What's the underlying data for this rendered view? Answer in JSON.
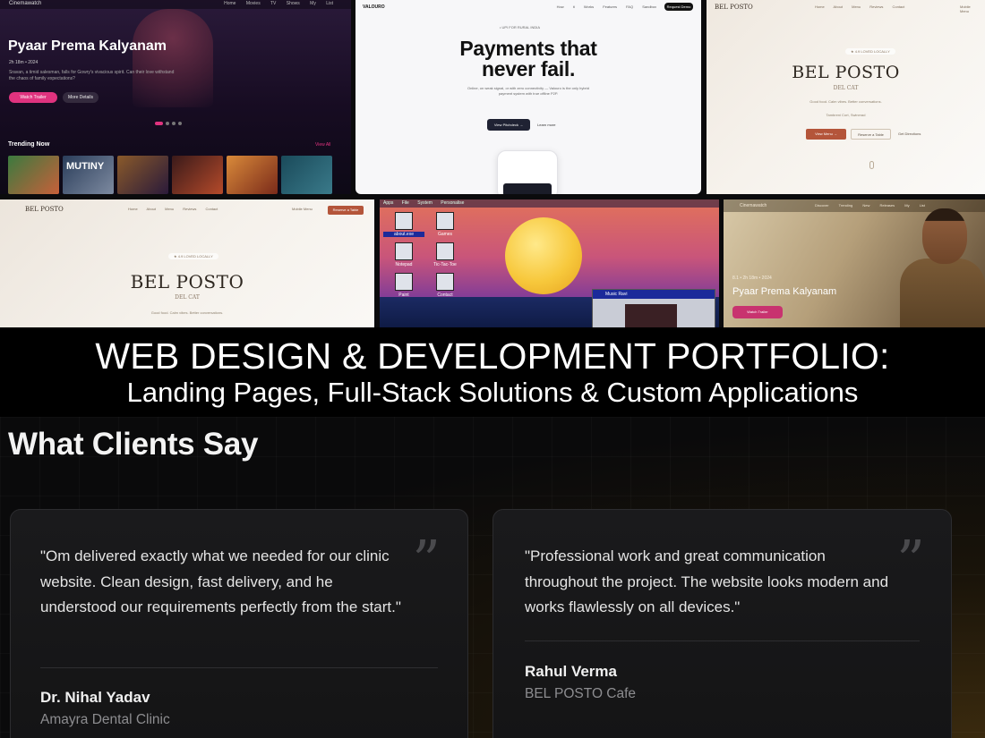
{
  "collage": {
    "streaming": {
      "brand": "Cinemawatch",
      "nav_links": "Home  Movies  TV Shows  My List",
      "hero_title": "Pyaar Prema Kalyanam",
      "meta": "2h 18m  •  2024",
      "description": "Sravan, a timid salesman, falls for Gowry's vivacious spirit. Can their love withstand the chaos of family expectations?",
      "watch_button": "Watch Trailer",
      "more_button": "More Details",
      "trending_label": "Trending Now",
      "view_all": "View All",
      "thumbnails": [
        {
          "label": "",
          "colors": [
            "#3b7a3f",
            "#c7603a"
          ]
        },
        {
          "label": "MUTINY",
          "colors": [
            "#2a3d5a",
            "#7d8aa0"
          ]
        },
        {
          "label": "",
          "colors": [
            "#8a5a2a",
            "#2a1a3a"
          ]
        },
        {
          "label": "",
          "colors": [
            "#3a1a1a",
            "#b54a2a"
          ]
        },
        {
          "label": "",
          "colors": [
            "#d98a3a",
            "#7a2a1a"
          ]
        },
        {
          "label": "",
          "colors": [
            "#1a4a5a",
            "#3a7a8a"
          ]
        }
      ]
    },
    "payments": {
      "brand": "VALOURO",
      "nav_links": "How it Works  Features  FAQ  Sandbox",
      "nav_button": "Request Demo",
      "badge": "• UPI FOR RURAL INDIA",
      "headline_line1": "Payments that",
      "headline_line2": "never fail.",
      "subtext": "Online, on weak signal, or with zero connectivity — Valouro is the only hybrid payment system with true offline P2P.",
      "primary_button": "View Pitchdeck →",
      "secondary_button": "Learn more"
    },
    "cafe_right": {
      "brand": "BEL POSTO",
      "nav_links": "Home  About  Menu  Reviews  Contact",
      "phone": "Mobile Menu",
      "rating": "★ 4.9  LOVED LOCALLY",
      "title": "BEL POSTO",
      "established": "DEL CAT",
      "tagline": "Good food. Calm vibes. Better conversations.",
      "address": "Tambreni Cort, Swinerad",
      "primary_button": "View Menu →",
      "ghost_button": "Reserve a Table",
      "link_button": "Get Directions"
    },
    "cafe_left": {
      "brand": "BEL POSTO",
      "nav_links": "Home  About  Menu  Reviews  Contact",
      "phone": "Mobile Menu",
      "cta": "Reserve a Table",
      "rating": "★ 4.9  LOVED LOCALLY",
      "title": "BEL POSTO",
      "established": "DEL CAT",
      "tagline": "Good food. Calm vibes. Better conversations."
    },
    "desktop": {
      "menubar": "Apps  File  System  Personalise",
      "icons": [
        {
          "label": "about.exe",
          "selected": true
        },
        {
          "label": "Games",
          "selected": false
        },
        {
          "label": "Notepad",
          "selected": false
        },
        {
          "label": "Tic-Tac-Toe",
          "selected": false
        },
        {
          "label": "Paint",
          "selected": false
        },
        {
          "label": "Contact",
          "selected": false
        }
      ],
      "window_title": "Music Ravi"
    },
    "streaming_detail": {
      "brand": "Cinemawatch",
      "nav_links": "Discover  Trending  New Releases  My List",
      "meta": "8.1  •  2h 18m  •  2024",
      "title": "Pyaar Prema Kalyanam",
      "button": "Watch Trailer"
    }
  },
  "banner": {
    "title": "WEB DESIGN & DEVELOPMENT PORTFOLIO:",
    "subtitle": "Landing Pages, Full-Stack Solutions & Custom Applications"
  },
  "testimonials": {
    "heading": "What Clients Say",
    "quote_icon": "quote-icon",
    "items": [
      {
        "quote": "\"Om delivered exactly what we needed for our clinic website. Clean design, fast delivery, and he understood our requirements perfectly from the start.\"",
        "author": "Dr. Nihal Yadav",
        "organization": "Amayra Dental Clinic"
      },
      {
        "quote": "\"Professional work and great communication throughout the project. The website looks modern and works flawlessly on all devices.\"",
        "author": "Rahul Verma",
        "organization": "BEL POSTO Cafe"
      }
    ]
  },
  "colors": {
    "streaming_accent": "#e0337f",
    "cafe_accent": "#b4553a",
    "payments_dark": "#1f2233",
    "section_background": "#0a0a0b"
  }
}
